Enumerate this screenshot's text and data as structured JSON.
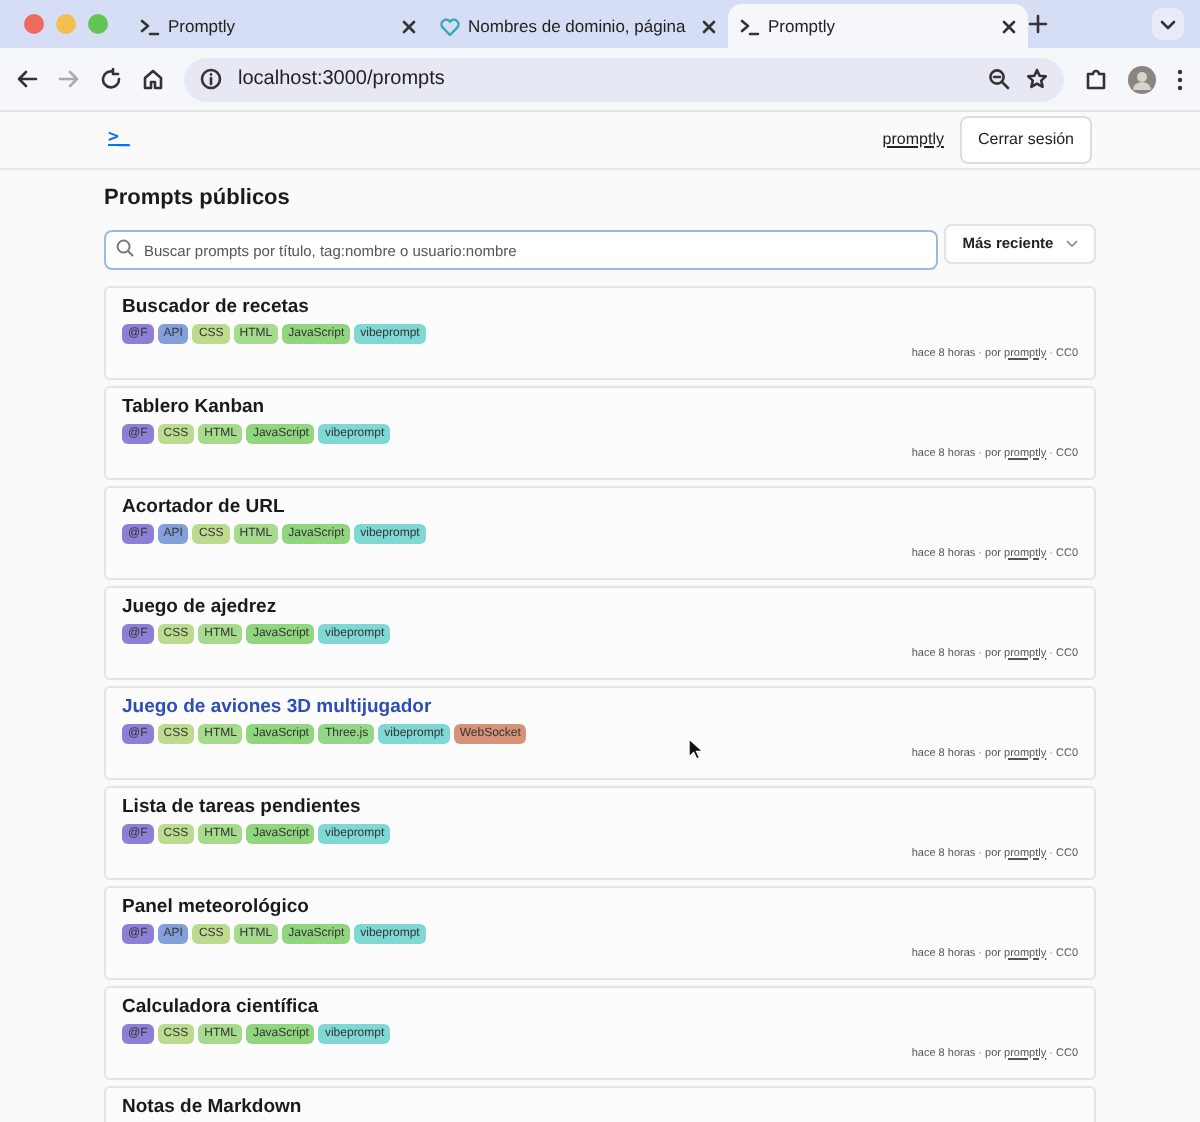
{
  "browser": {
    "tabs": [
      {
        "title": "Promptly",
        "selected": false
      },
      {
        "title": "Nombres de dominio, página",
        "selected": false
      },
      {
        "title": "Promptly",
        "selected": true
      }
    ],
    "address": "localhost:3000/prompts"
  },
  "header": {
    "logo": ">_",
    "user_link": "promptly",
    "logout_button": "Cerrar sesión"
  },
  "heading": "Prompts públicos",
  "search": {
    "placeholder": "Buscar prompts por título, tag:nombre o usuario:nombre"
  },
  "sort": {
    "value": "Más reciente"
  },
  "prompts": [
    {
      "title": "Buscador de recetas",
      "highlighted": false,
      "tags": [
        {
          "label": "@F",
          "color": "#8e7fd6"
        },
        {
          "label": "API",
          "color": "#84a0da"
        },
        {
          "label": "CSS",
          "color": "#bcdb8e"
        },
        {
          "label": "HTML",
          "color": "#a6da8c"
        },
        {
          "label": "JavaScript",
          "color": "#90d67e"
        },
        {
          "label": "vibeprompt",
          "color": "#7fd8d4"
        }
      ],
      "meta": "hace 8 horas · por",
      "author": "promptly",
      "license": "· CC0"
    },
    {
      "title": "Tablero Kanban",
      "highlighted": false,
      "tags": [
        {
          "label": "@F",
          "color": "#8e7fd6"
        },
        {
          "label": "CSS",
          "color": "#bcdb8e"
        },
        {
          "label": "HTML",
          "color": "#a6da8c"
        },
        {
          "label": "JavaScript",
          "color": "#90d67e"
        },
        {
          "label": "vibeprompt",
          "color": "#7fd8d4"
        }
      ],
      "meta": "hace 8 horas · por",
      "author": "promptly",
      "license": "· CC0"
    },
    {
      "title": "Acortador de URL",
      "highlighted": false,
      "tags": [
        {
          "label": "@F",
          "color": "#8e7fd6"
        },
        {
          "label": "API",
          "color": "#84a0da"
        },
        {
          "label": "CSS",
          "color": "#bcdb8e"
        },
        {
          "label": "HTML",
          "color": "#a6da8c"
        },
        {
          "label": "JavaScript",
          "color": "#90d67e"
        },
        {
          "label": "vibeprompt",
          "color": "#7fd8d4"
        }
      ],
      "meta": "hace 8 horas · por",
      "author": "promptly",
      "license": "· CC0"
    },
    {
      "title": "Juego de ajedrez",
      "highlighted": false,
      "tags": [
        {
          "label": "@F",
          "color": "#8e7fd6"
        },
        {
          "label": "CSS",
          "color": "#bcdb8e"
        },
        {
          "label": "HTML",
          "color": "#a6da8c"
        },
        {
          "label": "JavaScript",
          "color": "#90d67e"
        },
        {
          "label": "vibeprompt",
          "color": "#7fd8d4"
        }
      ],
      "meta": "hace 8 horas · por",
      "author": "promptly",
      "license": "· CC0"
    },
    {
      "title": "Juego de aviones 3D multijugador",
      "highlighted": true,
      "tags": [
        {
          "label": "@F",
          "color": "#8e7fd6"
        },
        {
          "label": "CSS",
          "color": "#bcdb8e"
        },
        {
          "label": "HTML",
          "color": "#a6da8c"
        },
        {
          "label": "JavaScript",
          "color": "#90d67e"
        },
        {
          "label": "Three.js",
          "color": "#92d886"
        },
        {
          "label": "vibeprompt",
          "color": "#7fd8d4"
        },
        {
          "label": "WebSocket",
          "color": "#d6937a"
        }
      ],
      "meta": "hace 8 horas · por",
      "author": "promptly",
      "license": "· CC0"
    },
    {
      "title": "Lista de tareas pendientes",
      "highlighted": false,
      "tags": [
        {
          "label": "@F",
          "color": "#8e7fd6"
        },
        {
          "label": "CSS",
          "color": "#bcdb8e"
        },
        {
          "label": "HTML",
          "color": "#a6da8c"
        },
        {
          "label": "JavaScript",
          "color": "#90d67e"
        },
        {
          "label": "vibeprompt",
          "color": "#7fd8d4"
        }
      ],
      "meta": "hace 8 horas · por",
      "author": "promptly",
      "license": "· CC0"
    },
    {
      "title": "Panel meteorológico",
      "highlighted": false,
      "tags": [
        {
          "label": "@F",
          "color": "#8e7fd6"
        },
        {
          "label": "API",
          "color": "#84a0da"
        },
        {
          "label": "CSS",
          "color": "#bcdb8e"
        },
        {
          "label": "HTML",
          "color": "#a6da8c"
        },
        {
          "label": "JavaScript",
          "color": "#90d67e"
        },
        {
          "label": "vibeprompt",
          "color": "#7fd8d4"
        }
      ],
      "meta": "hace 8 horas · por",
      "author": "promptly",
      "license": "· CC0"
    },
    {
      "title": "Calculadora científica",
      "highlighted": false,
      "tags": [
        {
          "label": "@F",
          "color": "#8e7fd6"
        },
        {
          "label": "CSS",
          "color": "#bcdb8e"
        },
        {
          "label": "HTML",
          "color": "#a6da8c"
        },
        {
          "label": "JavaScript",
          "color": "#90d67e"
        },
        {
          "label": "vibeprompt",
          "color": "#7fd8d4"
        }
      ],
      "meta": "hace 8 horas · por",
      "author": "promptly",
      "license": "· CC0"
    },
    {
      "title": "Notas de Markdown"
    }
  ]
}
